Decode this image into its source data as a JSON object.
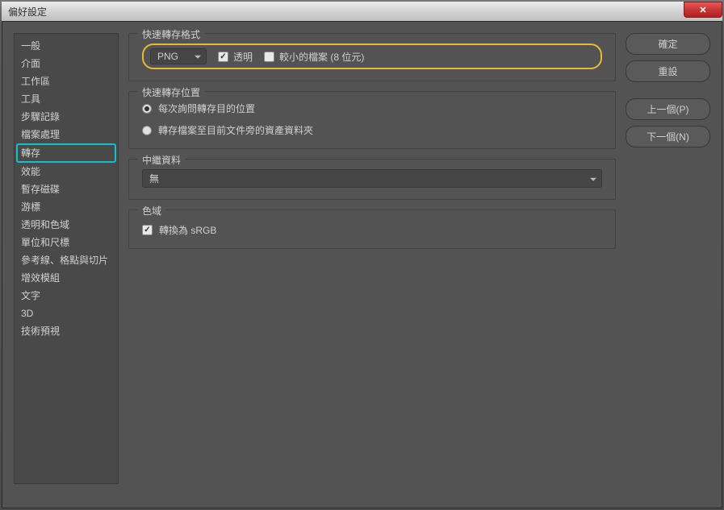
{
  "window": {
    "title": "偏好設定"
  },
  "sidebar": {
    "items": [
      {
        "label": "一般"
      },
      {
        "label": "介面"
      },
      {
        "label": "工作區"
      },
      {
        "label": "工具"
      },
      {
        "label": "步驟記錄"
      },
      {
        "label": "檔案處理"
      },
      {
        "label": "轉存",
        "selected": true
      },
      {
        "label": "效能"
      },
      {
        "label": "暫存磁碟"
      },
      {
        "label": "游標"
      },
      {
        "label": "透明和色域"
      },
      {
        "label": "單位和尺標"
      },
      {
        "label": "參考線、格點與切片"
      },
      {
        "label": "增效模組"
      },
      {
        "label": "文字"
      },
      {
        "label": "3D"
      },
      {
        "label": "技術預視"
      }
    ]
  },
  "groups": {
    "format": {
      "legend": "快速轉存格式",
      "dropdown": "PNG",
      "transparent_label": "透明",
      "transparent_checked": true,
      "smaller_label": "較小的檔案 (8 位元)",
      "smaller_checked": false
    },
    "location": {
      "legend": "快速轉存位置",
      "option_ask": "每次詢問轉存目的位置",
      "option_assets": "轉存檔案至目前文件旁的資產資料夾",
      "selected": "ask"
    },
    "metadata": {
      "legend": "中繼資料",
      "dropdown": "無"
    },
    "colorspace": {
      "legend": "色域",
      "convert_label": "轉換為 sRGB",
      "convert_checked": true
    }
  },
  "buttons": {
    "ok": "確定",
    "reset": "重設",
    "prev": "上一個(P)",
    "next": "下一個(N)"
  }
}
